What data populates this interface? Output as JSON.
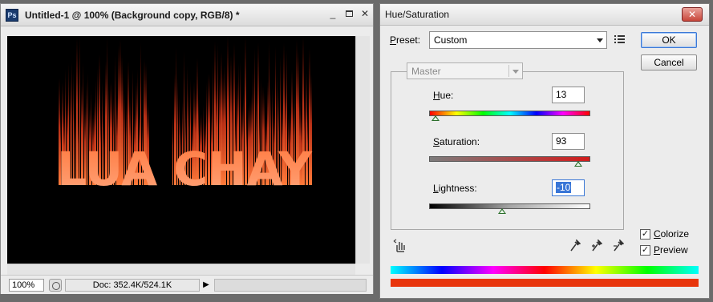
{
  "document": {
    "title": "Untitled-1 @ 100% (Background copy, RGB/8) *",
    "app_icon": "Ps",
    "minimize": "_",
    "close": "✕",
    "canvas_text": "LUA CHAY",
    "zoom": "100%",
    "doc_info": "Doc: 352.4K/524.1K",
    "status_arrow": "▶"
  },
  "dialog": {
    "title": "Hue/Saturation",
    "close": "✕",
    "preset": {
      "label_accel": "P",
      "label_rest": "reset:",
      "value": "Custom"
    },
    "buttons": {
      "ok": "OK",
      "cancel": "Cancel"
    },
    "channel": "Master",
    "hue": {
      "label_accel": "H",
      "label_rest": "ue:",
      "value": "13",
      "fraction": 0.036
    },
    "saturation": {
      "label_accel": "S",
      "label_rest": "aturation:",
      "value": "93",
      "fraction": 0.93
    },
    "lightness": {
      "label_accel": "L",
      "label_rest": "ightness:",
      "value": "-10",
      "fraction": 0.45
    },
    "colorize": {
      "label_accel": "C",
      "label_rest": "olorize",
      "checked": true,
      "mark": "✓"
    },
    "preview": {
      "label_accel": "P",
      "label_rest": "review",
      "checked": true,
      "mark": "✓"
    },
    "result_color": "#e8350c"
  }
}
